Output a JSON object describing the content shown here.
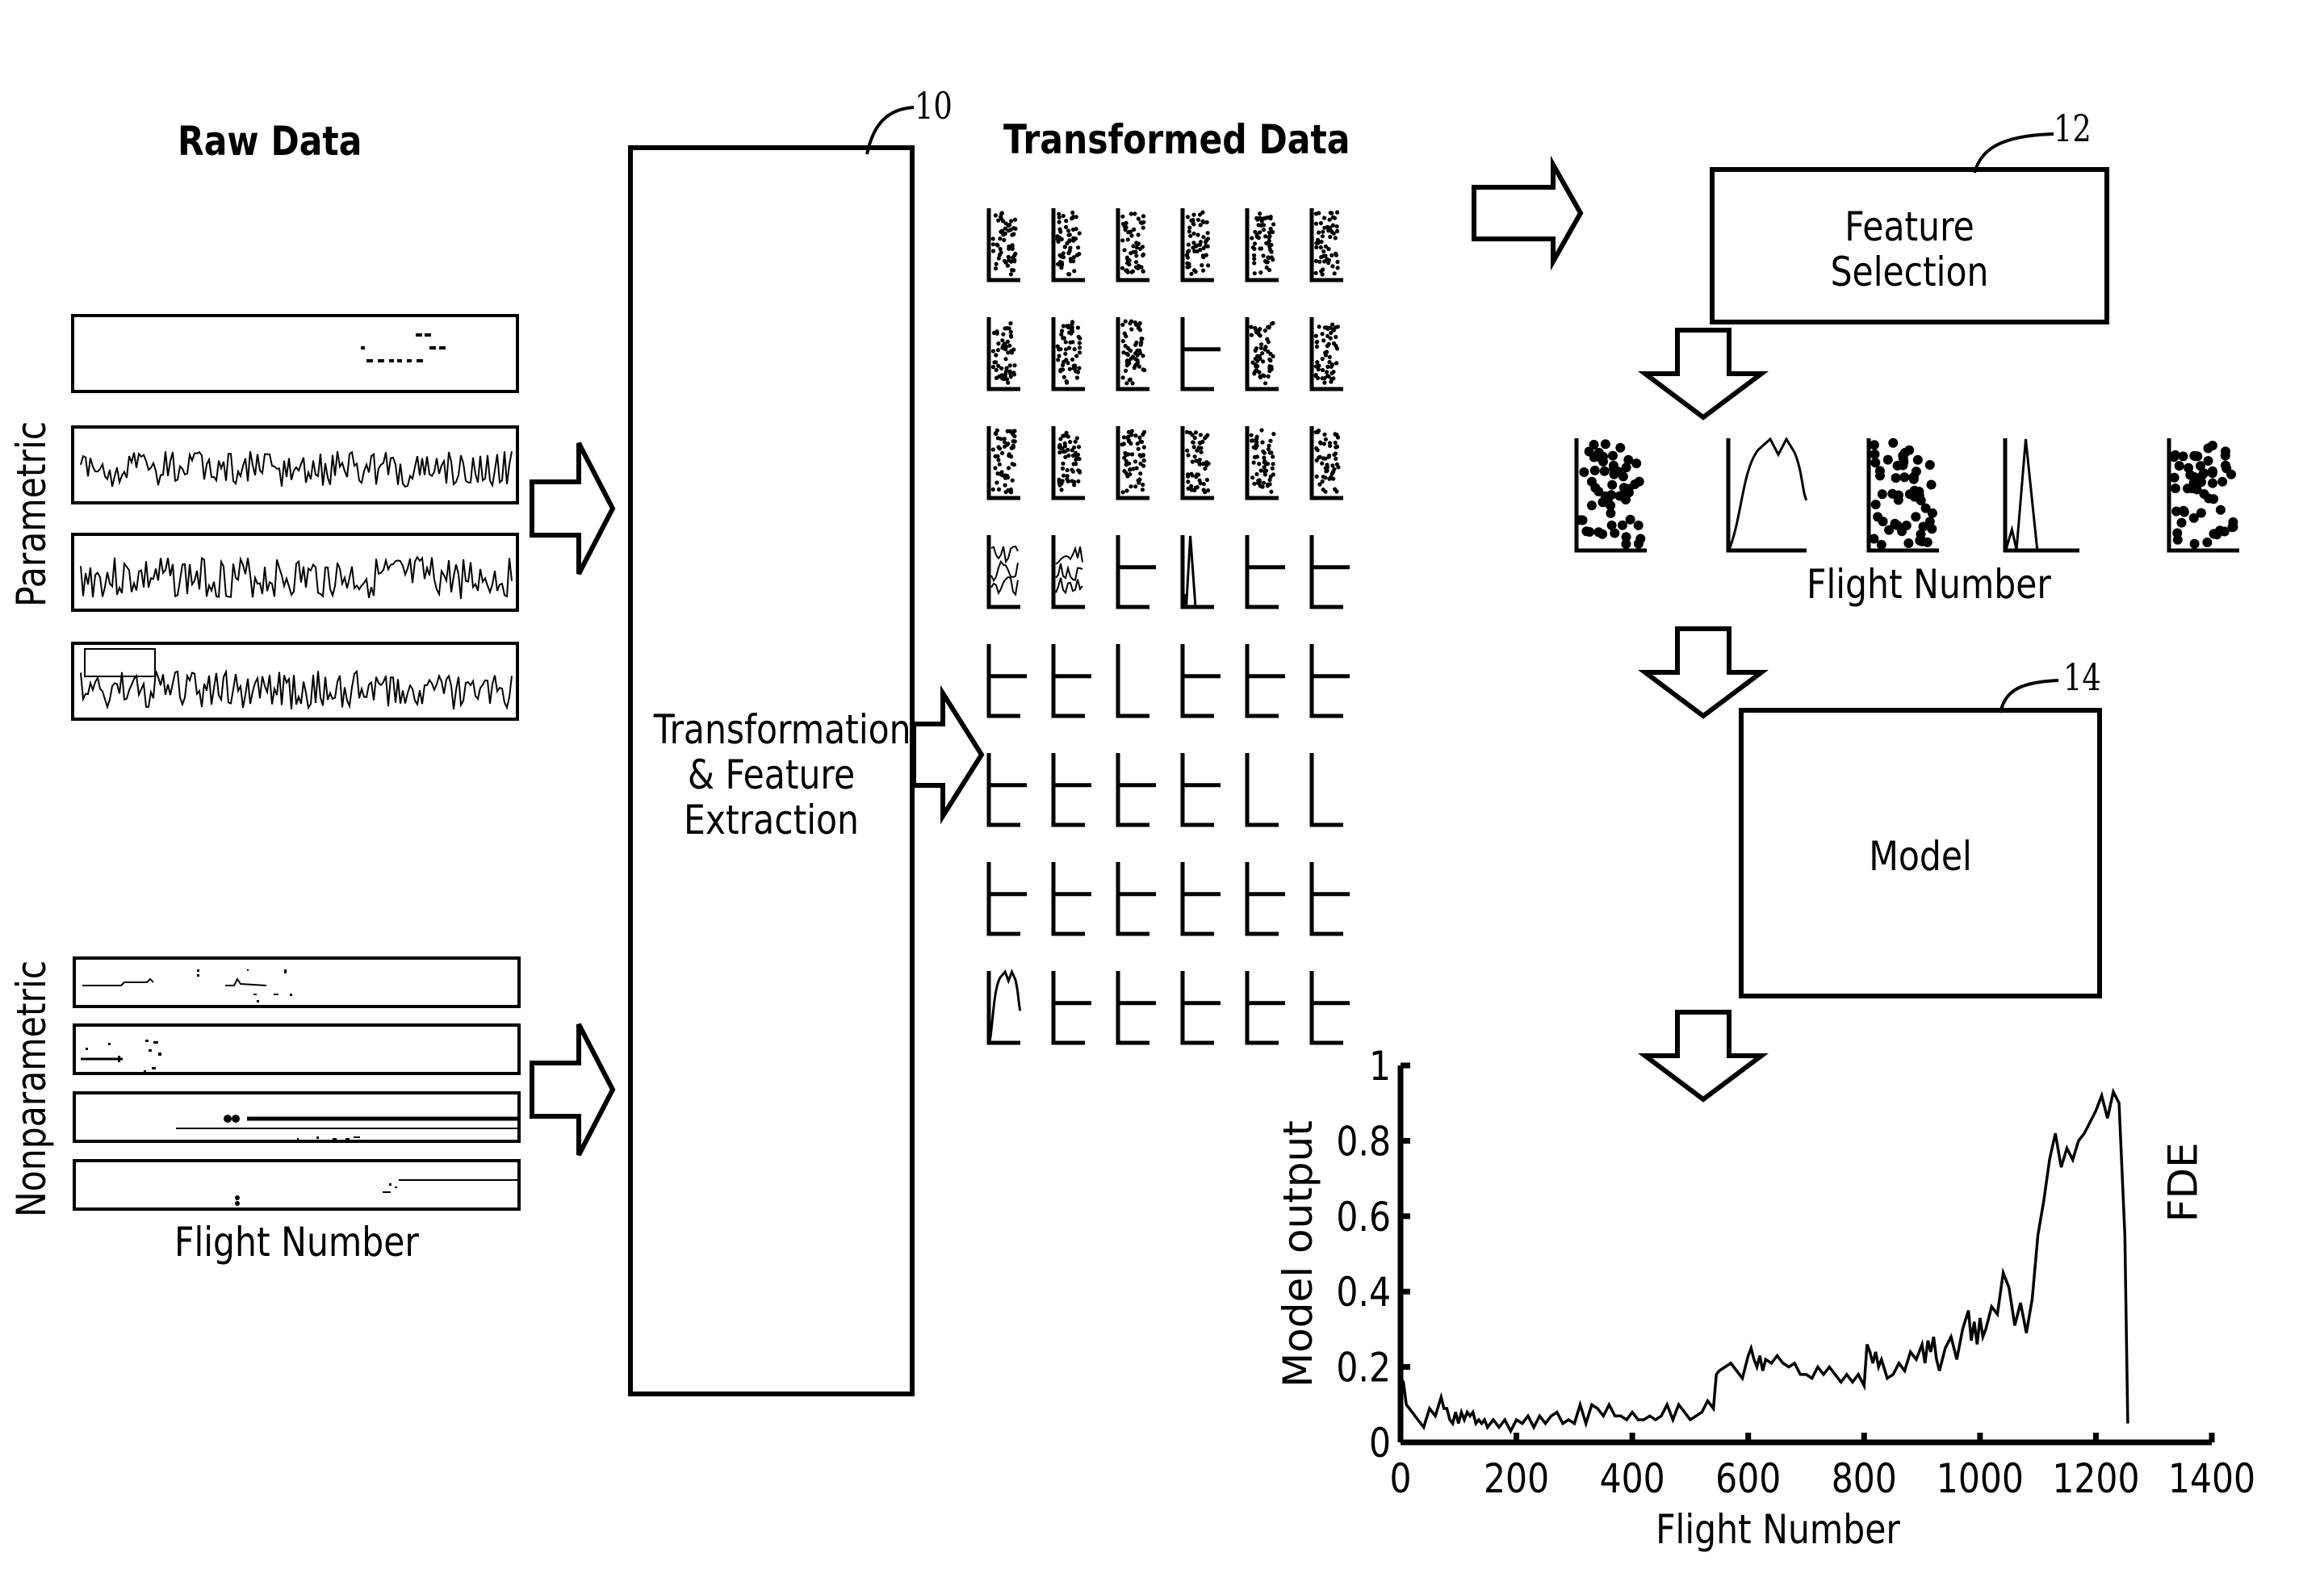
{
  "headings": {
    "raw_data": "Raw Data",
    "transformed_data": "Transformed Data"
  },
  "raw_data": {
    "parametric_label": "Parametric",
    "nonparametric_label": "Nonparametric",
    "x_label": "Flight Number",
    "parametric_panels": 4,
    "nonparametric_panels": 4
  },
  "blocks": {
    "transformation": {
      "ref": "10",
      "lines": [
        "Transformation",
        "& Feature",
        "Extraction"
      ]
    },
    "feature_selection": {
      "ref": "12",
      "lines": [
        "Feature",
        "Selection"
      ]
    },
    "model": {
      "ref": "14",
      "lines": [
        "Model"
      ]
    }
  },
  "transformed_grid": {
    "rows": 8,
    "cols": 6,
    "cells": [
      [
        "scatter",
        "scatter",
        "scatter",
        "scatter",
        "scatter",
        "scatter"
      ],
      [
        "scatter",
        "scatter",
        "scatter",
        "flat",
        "scatter",
        "scatter"
      ],
      [
        "scatter",
        "scatter",
        "scatter",
        "scatter",
        "scatter",
        "scatter"
      ],
      [
        "noisy",
        "noisy",
        "flat",
        "spike",
        "flat",
        "flat"
      ],
      [
        "flat",
        "flat",
        "empty",
        "flat",
        "flat",
        "flat"
      ],
      [
        "flat",
        "flat",
        "flat",
        "flat",
        "empty",
        "empty"
      ],
      [
        "flat",
        "flat",
        "flat",
        "flat",
        "flat",
        "flat"
      ],
      [
        "hump",
        "flat",
        "flat",
        "flat",
        "flat",
        "flat"
      ]
    ]
  },
  "selected_features": {
    "types": [
      "scatter",
      "hump",
      "scatter",
      "spike",
      "scatter"
    ],
    "x_label": "Flight Number"
  },
  "chart_data": {
    "type": "line",
    "title": "",
    "xlabel": "Flight Number",
    "ylabel": "Model output",
    "xlim": [
      0,
      1400
    ],
    "ylim": [
      0,
      1
    ],
    "xticks": [
      "0",
      "200",
      "400",
      "600",
      "800",
      "1000",
      "1200",
      "1400"
    ],
    "yticks": [
      "0",
      "0.2",
      "0.4",
      "0.6",
      "0.8",
      "1"
    ],
    "annotation": "FDE",
    "grid": false,
    "x": [
      0,
      5,
      10,
      20,
      30,
      40,
      50,
      60,
      70,
      75,
      80,
      85,
      90,
      95,
      100,
      105,
      110,
      115,
      120,
      125,
      130,
      135,
      140,
      145,
      150,
      160,
      170,
      180,
      190,
      200,
      210,
      220,
      230,
      240,
      250,
      260,
      270,
      280,
      290,
      300,
      310,
      320,
      330,
      340,
      350,
      360,
      370,
      380,
      390,
      400,
      410,
      420,
      430,
      440,
      450,
      460,
      470,
      480,
      490,
      500,
      510,
      520,
      530,
      540,
      545,
      550,
      560,
      570,
      580,
      590,
      600,
      605,
      610,
      615,
      620,
      625,
      630,
      640,
      650,
      660,
      670,
      680,
      690,
      700,
      710,
      720,
      730,
      740,
      750,
      760,
      770,
      780,
      790,
      800,
      805,
      810,
      815,
      820,
      825,
      830,
      840,
      850,
      860,
      870,
      880,
      890,
      900,
      905,
      910,
      915,
      920,
      925,
      930,
      940,
      950,
      960,
      970,
      980,
      985,
      990,
      995,
      1000,
      1005,
      1010,
      1020,
      1030,
      1040,
      1050,
      1060,
      1070,
      1080,
      1090,
      1100,
      1110,
      1120,
      1130,
      1140,
      1150,
      1160,
      1170,
      1180,
      1190,
      1200,
      1210,
      1220,
      1230,
      1240,
      1250,
      1255,
      1260,
      1262,
      1265,
      1270
    ],
    "y": [
      0.17,
      0.16,
      0.1,
      0.08,
      0.06,
      0.04,
      0.09,
      0.07,
      0.12,
      0.09,
      0.09,
      0.06,
      0.05,
      0.08,
      0.05,
      0.08,
      0.06,
      0.08,
      0.07,
      0.08,
      0.05,
      0.06,
      0.05,
      0.06,
      0.04,
      0.06,
      0.04,
      0.06,
      0.03,
      0.06,
      0.05,
      0.07,
      0.04,
      0.07,
      0.05,
      0.07,
      0.08,
      0.05,
      0.06,
      0.05,
      0.1,
      0.05,
      0.1,
      0.09,
      0.07,
      0.1,
      0.07,
      0.07,
      0.06,
      0.08,
      0.06,
      0.06,
      0.07,
      0.06,
      0.07,
      0.1,
      0.06,
      0.1,
      0.08,
      0.06,
      0.07,
      0.08,
      0.11,
      0.09,
      0.18,
      0.19,
      0.2,
      0.21,
      0.19,
      0.17,
      0.23,
      0.25,
      0.22,
      0.2,
      0.23,
      0.19,
      0.22,
      0.21,
      0.23,
      0.21,
      0.2,
      0.21,
      0.18,
      0.18,
      0.17,
      0.2,
      0.18,
      0.2,
      0.18,
      0.16,
      0.18,
      0.16,
      0.18,
      0.15,
      0.26,
      0.24,
      0.21,
      0.24,
      0.2,
      0.22,
      0.17,
      0.18,
      0.21,
      0.19,
      0.24,
      0.22,
      0.26,
      0.21,
      0.27,
      0.24,
      0.28,
      0.22,
      0.19,
      0.25,
      0.28,
      0.22,
      0.3,
      0.35,
      0.27,
      0.32,
      0.26,
      0.33,
      0.28,
      0.3,
      0.36,
      0.34,
      0.45,
      0.41,
      0.31,
      0.37,
      0.29,
      0.38,
      0.55,
      0.64,
      0.75,
      0.82,
      0.73,
      0.78,
      0.75,
      0.8,
      0.82,
      0.85,
      0.88,
      0.92,
      0.86,
      0.93,
      0.9,
      0.55,
      0.05
    ],
    "series": [
      {
        "name": "Model output",
        "values": "see y"
      }
    ]
  }
}
